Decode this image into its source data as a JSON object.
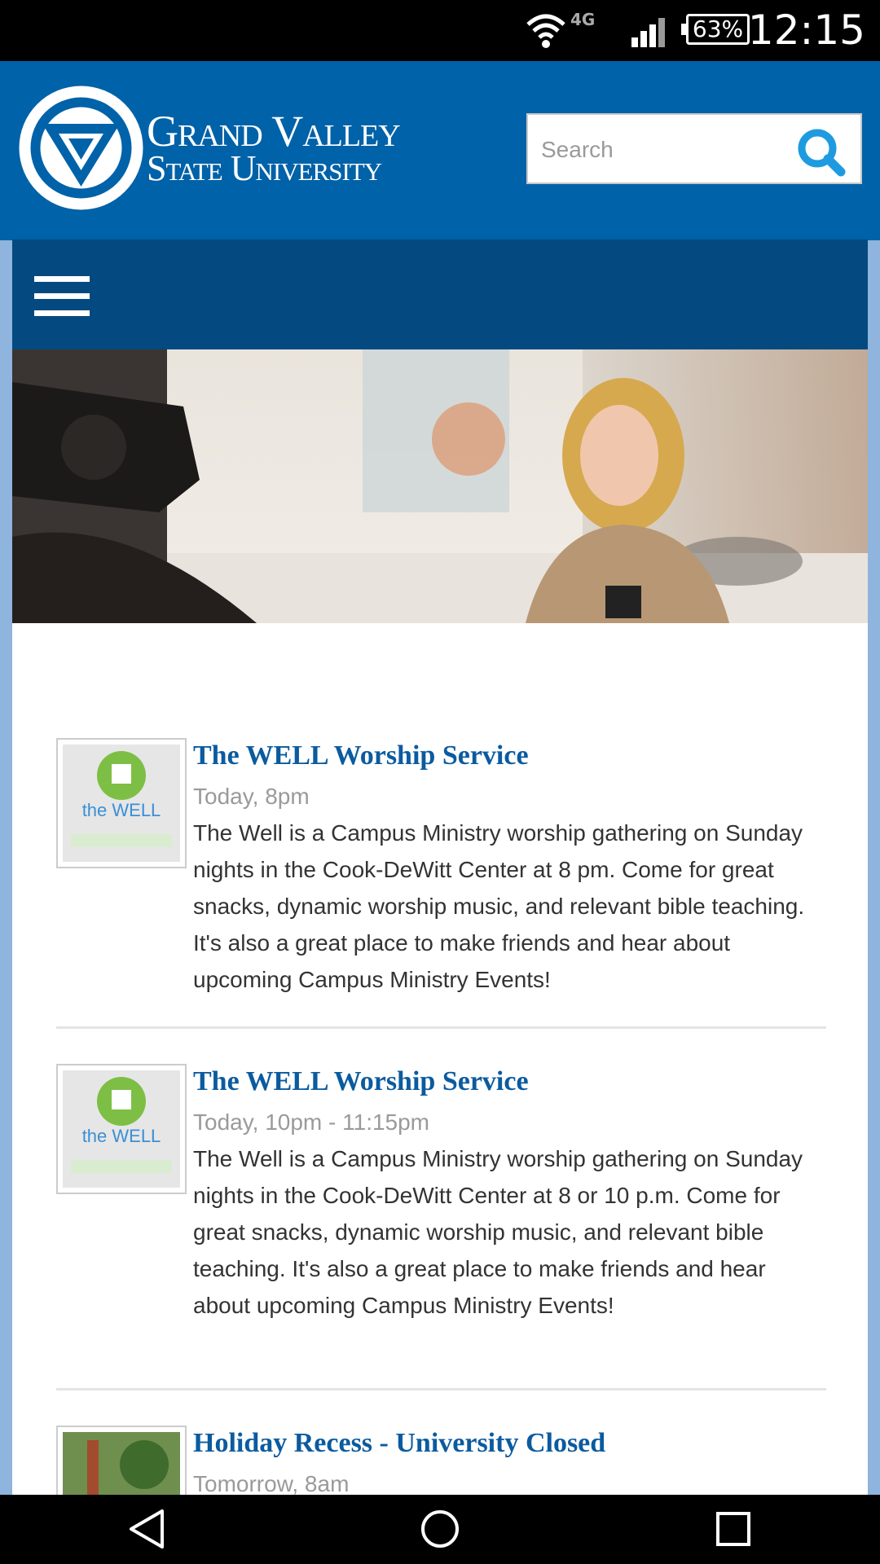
{
  "status_bar": {
    "time": "12:15",
    "battery": "63%",
    "network": "4G"
  },
  "header": {
    "logo_line1": "Grand Valley",
    "logo_line2": "State University",
    "search_placeholder": "Search"
  },
  "colors": {
    "header_blue": "#0062a8",
    "nav_blue": "#044a80",
    "link_blue": "#0b5b9f",
    "accent_cyan": "#1e9be0"
  },
  "events": [
    {
      "title": "The WELL Worship Service",
      "time": "Today, 8pm",
      "description": "The Well is a Campus Ministry worship gathering on Sunday nights in the Cook-DeWitt Center at 8 pm. Come for great snacks, dynamic worship music, and relevant bible teaching. It's also a great place to make friends and hear about upcoming Campus Ministry Events!",
      "thumb_text": "the WELL"
    },
    {
      "title": "The WELL Worship Service",
      "time": "Today, 10pm - 11:15pm",
      "description": "The Well is a Campus Ministry worship gathering on Sunday nights in the Cook-DeWitt Center at 8 or 10 p.m. Come for great snacks, dynamic worship music, and relevant bible teaching. It's also a great place to make friends and hear about upcoming Campus Ministry Events!",
      "thumb_text": "the WELL"
    },
    {
      "title": "Holiday Recess - University Closed",
      "time": "Tomorrow, 8am"
    }
  ],
  "icons": {
    "search": "search-icon",
    "menu": "hamburger-menu-icon",
    "back": "back-icon",
    "home": "home-icon",
    "recents": "recents-icon"
  }
}
